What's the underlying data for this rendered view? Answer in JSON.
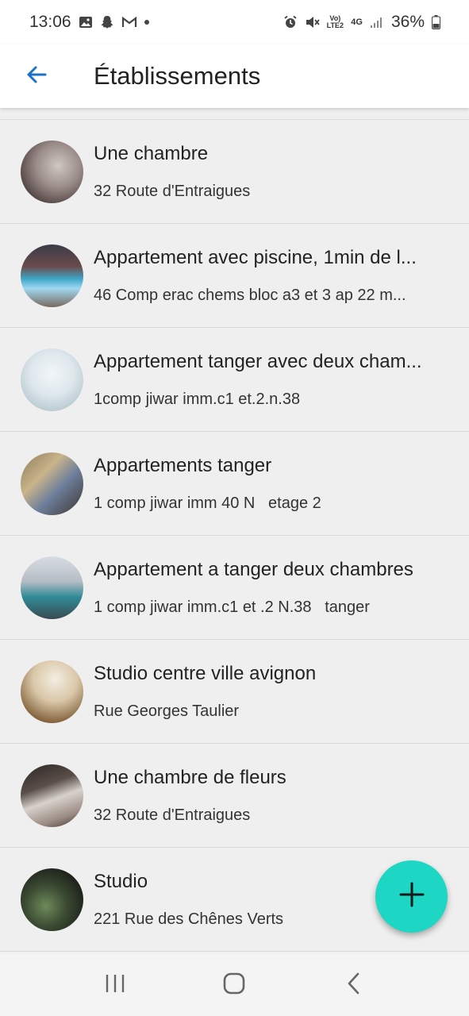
{
  "status_bar": {
    "time": "13:06",
    "battery": "36%",
    "network_label": "4G",
    "volte_label": "Vo) LTE2"
  },
  "app_bar": {
    "title": "Établissements"
  },
  "establishments": [
    {
      "title": "Une chambre",
      "address": "32 Route d'Entraigues"
    },
    {
      "title": "Appartement avec piscine, 1min de l...",
      "address": "46 Comp erac chems bloc a3 et 3 ap 22 m..."
    },
    {
      "title": "Appartement tanger avec deux cham...",
      "address": "1comp jiwar imm.c1 et.2.n.38"
    },
    {
      "title": "Appartements tanger",
      "address": "1 comp jiwar imm 40 N   etage 2"
    },
    {
      "title": "Appartement a tanger deux chambres",
      "address": "1 comp jiwar imm.c1 et .2 N.38   tanger"
    },
    {
      "title": "Studio centre ville avignon",
      "address": "Rue Georges Taulier"
    },
    {
      "title": "Une chambre de fleurs",
      "address": "32 Route d'Entraigues"
    },
    {
      "title": "Studio",
      "address": "221 Rue des Chênes Verts"
    }
  ],
  "colors": {
    "accent": "#1dd6c4",
    "back_arrow": "#1a73c9"
  },
  "icons": {
    "back": "arrow-left-icon",
    "fab": "plus-icon",
    "nav_recents": "recents-icon",
    "nav_home": "home-icon",
    "nav_back": "chevron-left-icon"
  }
}
